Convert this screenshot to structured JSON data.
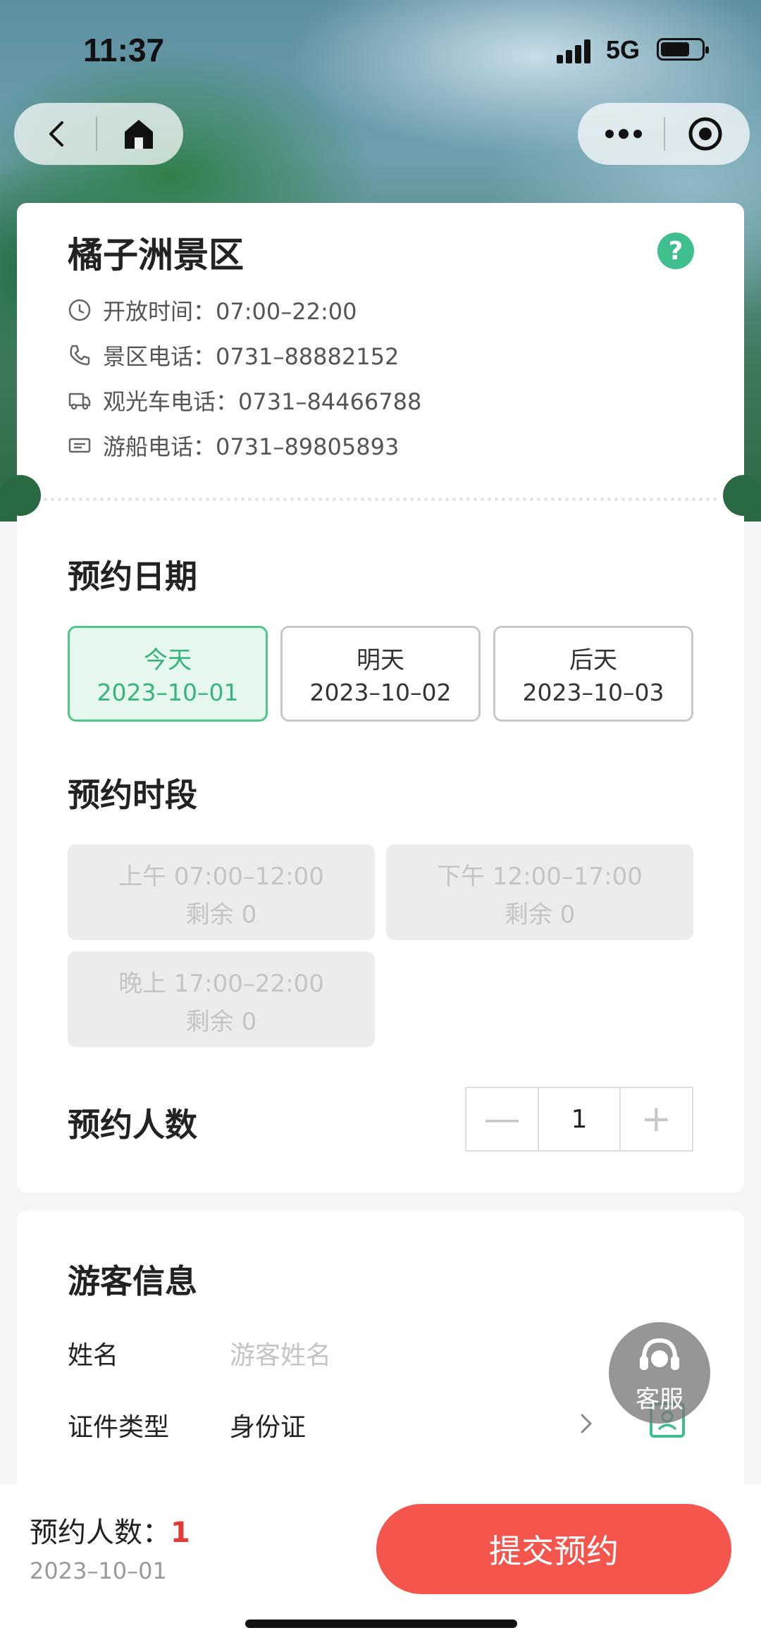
{
  "status": {
    "time": "11:37",
    "network": "5G"
  },
  "nav": {
    "back_icon": "chevron-left-icon",
    "home_icon": "home-icon",
    "more_icon": "more-dots-icon",
    "close_icon": "target-circle-icon"
  },
  "scenic": {
    "name": "橘子洲景区",
    "help": "?",
    "open_hours": "开放时间：07:00–22:00",
    "phone": "景区电话：0731–88882152",
    "bus_phone": "观光车电话：0731–84466788",
    "boat_phone": "游船电话：0731–89805893"
  },
  "booking": {
    "date_title": "预约日期",
    "dates": [
      {
        "label": "今天",
        "date": "2023–10–01"
      },
      {
        "label": "明天",
        "date": "2023–10–02"
      },
      {
        "label": "后天",
        "date": "2023–10–03"
      }
    ],
    "slot_title": "预约时段",
    "slots": [
      {
        "time": "上午 07:00–12:00",
        "remain": "剩余 0"
      },
      {
        "time": "下午 12:00–17:00",
        "remain": "剩余 0"
      },
      {
        "time": "晚上 17:00–22:00",
        "remain": "剩余 0"
      }
    ],
    "people_title": "预约人数",
    "people_minus": "—",
    "people_count": "1",
    "people_plus": "+"
  },
  "visitor": {
    "title": "游客信息",
    "name_label": "姓名",
    "name_placeholder": "游客姓名",
    "id_type_label": "证件类型",
    "id_type_value": "身份证"
  },
  "service": {
    "label": "客服"
  },
  "footer": {
    "count_label": "预约人数：",
    "count_value": "1",
    "date": "2023–10–01",
    "submit": "提交预约"
  },
  "colors": {
    "accent": "#3fbf8e",
    "submit": "#f4554c",
    "count": "#e53935"
  }
}
